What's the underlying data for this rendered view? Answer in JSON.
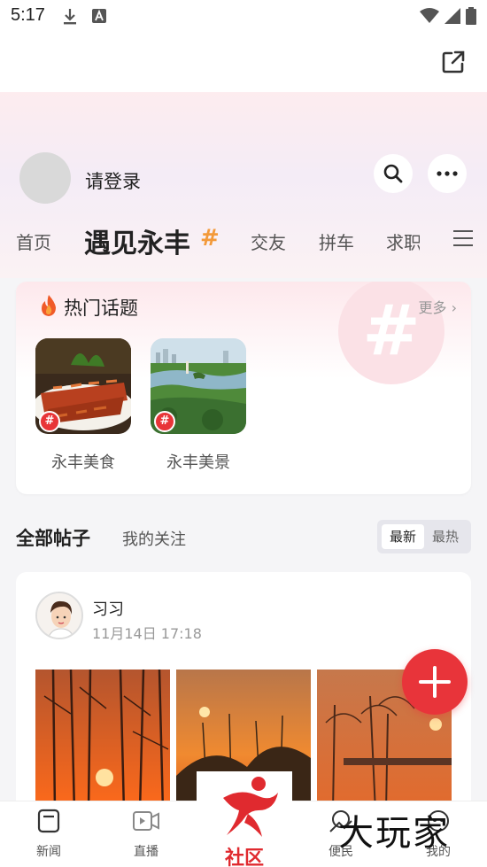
{
  "status_bar": {
    "time": "5:17"
  },
  "header": {
    "login_text": "请登录",
    "tabs": [
      "首页",
      "遇见永丰",
      "交友",
      "拼车",
      "求职"
    ],
    "active_tab_index": 1
  },
  "hot_topics": {
    "title": "热门话题",
    "more_label": "更多 ›",
    "items": [
      {
        "label": "永丰美食"
      },
      {
        "label": "永丰美景"
      }
    ]
  },
  "posts": {
    "tab_all": "全部帖子",
    "tab_follow": "我的关注",
    "sort_newest": "最新",
    "sort_hottest": "最热",
    "items": [
      {
        "author": "习习",
        "time": "11月14日 17:18"
      }
    ]
  },
  "bottom_nav": {
    "items": [
      {
        "label": "新闻"
      },
      {
        "label": "直播"
      },
      {
        "label": "社区"
      },
      {
        "label": "便民"
      },
      {
        "label": "我的"
      }
    ],
    "active_index": 2
  },
  "watermark": "大玩家",
  "colors": {
    "accent": "#e8343a",
    "hash_orange": "#f39a3a"
  }
}
